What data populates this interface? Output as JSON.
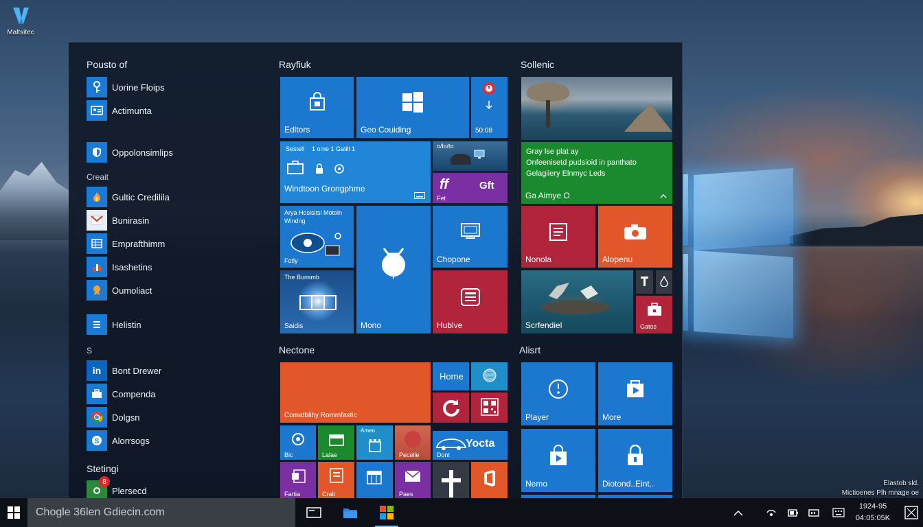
{
  "desktop": {
    "icon_label": "Maltsitec",
    "corner_note": [
      "Elastob sld.",
      "Mictioenes Plh mnage oe"
    ]
  },
  "start_menu": {
    "app_list": {
      "section_1": "Pousto of",
      "items_1": [
        {
          "name": "Uorine Floips",
          "icon": "key-icon"
        },
        {
          "name": "Actimunta",
          "icon": "id-card-icon"
        }
      ],
      "items_2": [
        {
          "name": "Oppolonsimlips",
          "icon": "shield-icon"
        }
      ],
      "section_2": "Creait",
      "items_3": [
        {
          "name": "Gultic Credilila",
          "icon": "flame-icon"
        },
        {
          "name": "Bunirasin",
          "icon": "gmail-icon"
        },
        {
          "name": "Emprafthimm",
          "icon": "table-icon"
        },
        {
          "name": "Isashetins",
          "icon": "chart-icon"
        },
        {
          "name": "Oumoliact",
          "icon": "badge-icon"
        }
      ],
      "items_4": [
        {
          "name": "Helistin",
          "icon": "list-icon"
        }
      ],
      "letter_s": "S",
      "items_5": [
        {
          "name": "Bont Drewer",
          "icon": "linkedin-icon"
        },
        {
          "name": "Compenda",
          "icon": "briefcase-icon"
        },
        {
          "name": "Dolgsn",
          "icon": "chrome-icon"
        },
        {
          "name": "Alorrsogs",
          "icon": "skype-icon"
        }
      ],
      "section_3": "Stetingi",
      "items_6": [
        {
          "name": "Plersecd",
          "icon": "settings-icon",
          "badge": "8"
        }
      ]
    },
    "groups": {
      "g1_title": "Rayfiuk",
      "g2_title": "Sollenic",
      "g3_title": "Nectone",
      "g4_title": "Alisrt"
    },
    "tiles": {
      "editors": "Edltors",
      "geo_coding": "Geo Couiding",
      "small_date": "50:08",
      "mail_header_a": "Sestell",
      "mail_header_b": "1 ome 1 Gatill 1",
      "window_groups": "Windtoon Grongphme",
      "video_top": "o/lo/to",
      "weather_head": "Gray lse plat ay",
      "weather_line2": "Onfeenisetd pudsioid in panthato",
      "weather_line3": "Gelagiiery Elnmyc Leds",
      "weather_foot": "Ga Aimye O",
      "ff": "ff",
      "gift": "Gft",
      "fet": "Fet",
      "app_studio_a": "Arya Hosisitsl Motoin",
      "app_studio_b": "Windng",
      "fottly": "Fotly",
      "chopone": "Chopone",
      "monola": "Nonola",
      "alopeni": "Alopenu",
      "the_storm": "The Bunsmb",
      "saudis": "Saidis",
      "mono": "Mono",
      "hublive": "Hublve",
      "screndiel": "Scrfendiel",
      "gatios": "Gatos",
      "comm_tile": "Comatblihy Rommfastic",
      "home": "Home",
      "yocta": "Yocta",
      "dont": "Dont",
      "bic": "Bic",
      "lalae": "Lalae",
      "amea": "Ameo",
      "pecelle": "Pecelle",
      "fartia": "Fartia",
      "cralt": "Cralt",
      "paes": "Paes",
      "player": "Player",
      "more": "More",
      "nemo": "Nemo",
      "diotond": "Diotond..Eint.."
    }
  },
  "taskbar": {
    "search_placeholder": "Chogle 36len Gdiecin.com",
    "clock_time": "1924-95",
    "clock_date": "04:05:05K"
  },
  "colors": {
    "accent_blue": "#1c78cf",
    "tile_green": "#1b8a2e",
    "tile_purple": "#7a2fa2",
    "tile_red": "#b2243c",
    "tile_orange": "#e2572a",
    "taskbar_bg": "#0c1016"
  }
}
